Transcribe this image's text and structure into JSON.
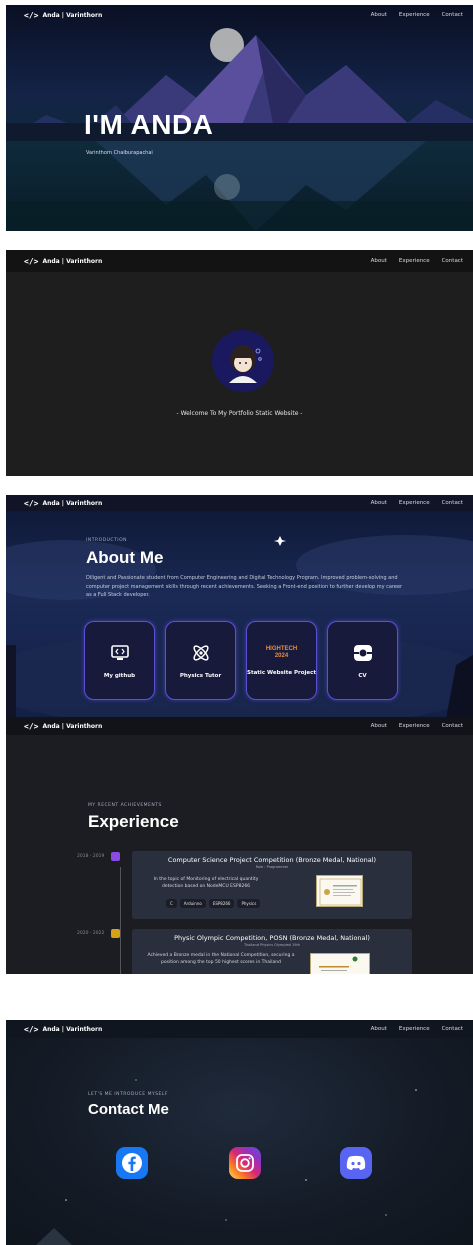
{
  "nav": {
    "brand": "Anda | Varinthorn",
    "links": [
      "About",
      "Experience",
      "Contact"
    ]
  },
  "hero": {
    "title": "I'M ANDA",
    "subtitle": "Varinthorn Chaiburapachai"
  },
  "welcome": {
    "text": "- Welcome To My Portfolio Static Website -"
  },
  "about": {
    "eyebrow": "INTRODUCTION",
    "title": "About Me",
    "description": "Diligent and Passionate student from Computer Engineering and Digital Technology Program. Improved problem-solving and computer project management skills through recent achievements. Seeking a Front-end position to further develop my career as a Full Stack developer.",
    "cards": [
      {
        "label": "My github",
        "icon": "monitor-code-icon"
      },
      {
        "label": "Physics Tutor",
        "icon": "atom-icon"
      },
      {
        "label": "Static Website Project",
        "icon": "hightech-logo",
        "badge_line1": "HIGHTECH",
        "badge_line2": "2024"
      },
      {
        "label": "CV",
        "icon": "cv-icon"
      }
    ]
  },
  "experience": {
    "eyebrow": "MY RECENT ACHIEVEMENTS",
    "title": "Experience",
    "items": [
      {
        "years": "2018 - 2019",
        "title": "Computer Science Project Competition (Bronze Medal, National)",
        "role": "Role : Programmer",
        "description": "In the topic of Monitoring of electrical quantity detection based on NodeMCU ESP8266",
        "tags": [
          "C",
          "Arduinno",
          "ESP8266",
          "Physics"
        ],
        "color": "#8a4be0"
      },
      {
        "years": "2020 - 2022",
        "title": "Physic Olympic Competition, POSN (Bronze Medal, National)",
        "role": "Thailand Physics Olympiad 19th",
        "description": "Achieved a Bronze medal in the National Competition, securing a position among the top 50 highest scores in Thailand",
        "tags": [],
        "color": "#d8a016"
      }
    ]
  },
  "contact": {
    "eyebrow": "LET'S ME INTRODUCE MYSELF",
    "title": "Contact Me",
    "socials": [
      {
        "name": "facebook-button",
        "icon": "facebook-icon",
        "color": "#1877f2"
      },
      {
        "name": "instagram-button",
        "icon": "instagram-icon",
        "color": "#d62976"
      },
      {
        "name": "discord-button",
        "icon": "discord-icon",
        "color": "#5865f2"
      }
    ]
  },
  "colors": {
    "accent": "#5b4fd6",
    "dark_bg": "#1e1e1e"
  }
}
